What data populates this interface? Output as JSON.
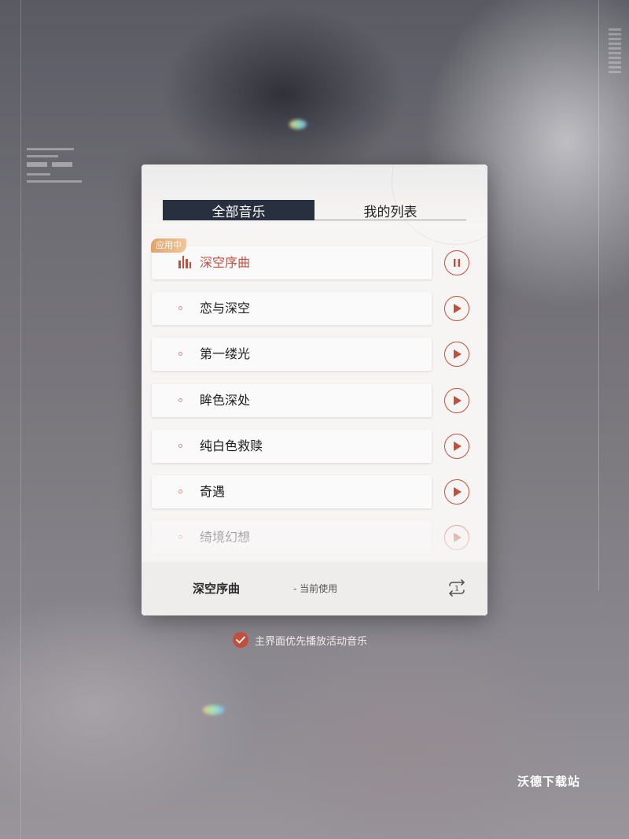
{
  "tabs": {
    "all_music": "全部音乐",
    "my_list": "我的列表"
  },
  "badge": "应用中",
  "songs": [
    {
      "title": "深空序曲",
      "state": "playing",
      "icon": "pause-icon"
    },
    {
      "title": "恋与深空",
      "state": "idle",
      "icon": "play-icon"
    },
    {
      "title": "第一缕光",
      "state": "idle",
      "icon": "play-icon"
    },
    {
      "title": "眸色深处",
      "state": "idle",
      "icon": "play-icon"
    },
    {
      "title": "纯白色救赎",
      "state": "idle",
      "icon": "play-icon"
    },
    {
      "title": "奇遇",
      "state": "idle",
      "icon": "play-icon"
    },
    {
      "title": "绮境幻想",
      "state": "idle",
      "icon": "play-icon"
    }
  ],
  "footer": {
    "current_song": "深空序曲",
    "status": "- 当前使用",
    "loop_count": "1"
  },
  "preference": {
    "label": "主界面优先播放活动音乐",
    "checked": true
  },
  "watermark": "沃德下载站",
  "colors": {
    "accent": "#c24f3d",
    "tab_active_bg": "#283040",
    "badge": "#e9b07a"
  }
}
